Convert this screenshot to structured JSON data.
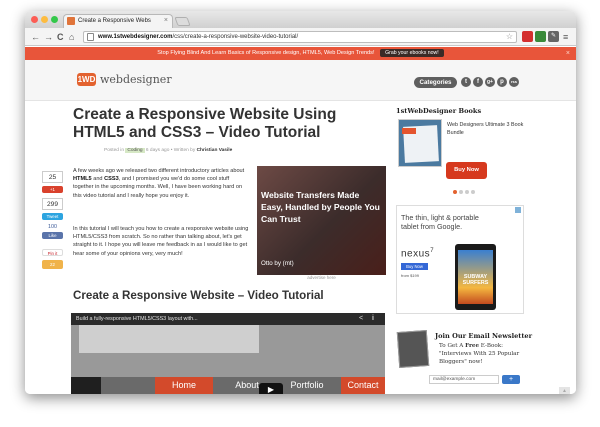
{
  "browser": {
    "tab_title": "Create a Responsive Webs",
    "tab_close": "×",
    "url_domain": "www.1stwebdesigner.com",
    "url_path": "/css/create-a-responsive-website-video-tutorial/",
    "back": "←",
    "forward": "→",
    "reload": "C",
    "home": "⌂",
    "star": "☆",
    "menu": "≡",
    "colors": {
      "tab_favicon": "#e0743a",
      "close_btn": "#fc5d55",
      "min_btn": "#fdbc40",
      "max_btn": "#34c84a"
    }
  },
  "promo": {
    "text": "Stop Flying Blind And Learn Basics of Responsive design, HTML5, Web Design Trends!",
    "button": "Grab your ebooks now!",
    "close": "×",
    "color": "#e8553a"
  },
  "header": {
    "logo_mark": "1WD",
    "logo_text": "webdesigner",
    "categories": "Categories",
    "social": [
      "t",
      "f",
      "g+",
      "p",
      "rss"
    ]
  },
  "article": {
    "title": "Create a Responsive Website Using HTML5 and CSS3 – Video Tutorial",
    "meta_prefix": "Posted in",
    "meta_category": "Coding",
    "meta_middle": "6 days ago • Written by",
    "meta_author": "Christian Vasile",
    "para1_a": "A few weeks ago we released two different introductory articles about ",
    "para1_html5": "HTML5",
    "para1_b": " and ",
    "para1_css3": "CSS3",
    "para1_c": ", and I promised you we'd do some cool stuff together in the upcoming months. Well, I have been working hard on this video tutorial and I really hope you enjoy it.",
    "para2": "In this tutorial I will teach you how to create a responsive website using HTML5/CSS3 from scratch. So no rather than talking about, let's get straight to it. I hope you will leave me feedback in as I would like to get hear some of your opinions very, very much!",
    "subheading": "Create a Responsive Website – Video Tutorial"
  },
  "share": {
    "count1": "25",
    "gplus": "+1",
    "count2": "299",
    "tweet": "Tweet",
    "like_count": "100",
    "like": "Like",
    "pinit": "Pin it",
    "count3": "22"
  },
  "ad": {
    "text": "Website Transfers Made Easy, Handled by People You Can Trust",
    "logo": "Otto by (mt)",
    "caption": "advertise here"
  },
  "video": {
    "title": "Build a fully-responsive HTML5/CSS3 layout with...",
    "share_icon": "<",
    "info_icon": "i",
    "nav": [
      "Home",
      "About",
      "Portfolio",
      "Contact"
    ],
    "play": "▶"
  },
  "sidebar": {
    "books_heading": "1stWebDesigner Books",
    "bundle_title": "Web Designers Ultimate 3 Book Bundle",
    "buy_now": "Buy Now",
    "google_ad": {
      "headline": "The thin, light & portable tablet from Google.",
      "product": "nexus",
      "product_sup": "7",
      "buy": "Buy Now",
      "price": "from $199",
      "game": "SUBWAY SURFERS"
    },
    "newsletter": {
      "heading": "Join Our Email Newsletter",
      "desc_a": "To Get A ",
      "desc_free": "Free",
      "desc_b": " E-Book: \"Interviews With 25 Popular Bloggers\" now!",
      "placeholder": "mail@example.com",
      "button": "+"
    }
  },
  "colors": {
    "accent": "#e3622f",
    "buy_red": "#d6391e",
    "video_nav_active": "#d34a2b"
  }
}
